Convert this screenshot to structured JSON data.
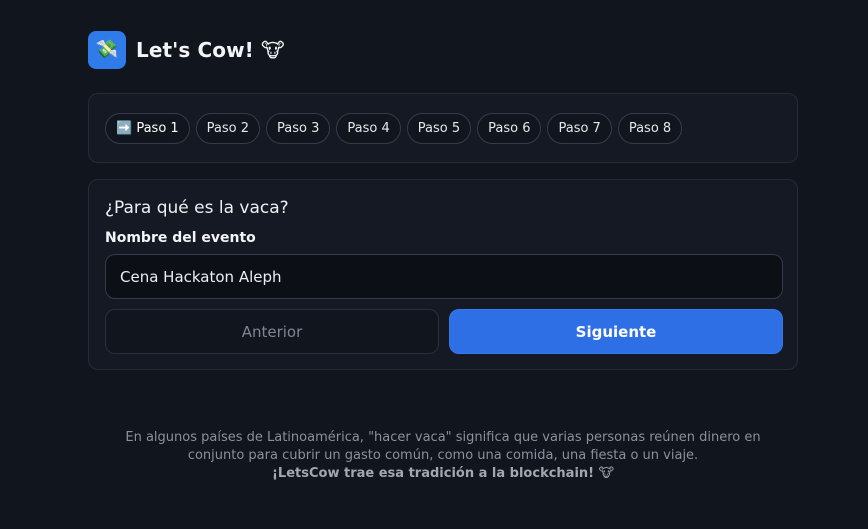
{
  "header": {
    "logo_icon": "💸",
    "title": "Let's Cow! 🐮"
  },
  "steps": [
    {
      "label": "➡️ Paso 1",
      "active": true
    },
    {
      "label": "Paso 2"
    },
    {
      "label": "Paso 3"
    },
    {
      "label": "Paso 4"
    },
    {
      "label": "Paso 5"
    },
    {
      "label": "Paso 6"
    },
    {
      "label": "Paso 7"
    },
    {
      "label": "Paso 8"
    }
  ],
  "form": {
    "question": "¿Para qué es la vaca?",
    "field_label": "Nombre del evento",
    "event_name_value": "Cena Hackaton Aleph",
    "prev_label": "Anterior",
    "next_label": "Siguiente"
  },
  "footer": {
    "line1": "En algunos países de Latinoamérica, \"hacer vaca\" significa que varias personas reúnen dinero en",
    "line2": "conjunto para cubrir un gasto común, como una comida, una fiesta o un viaje.",
    "tagline": "¡LetsCow trae esa tradición a la blockchain! 🐮"
  },
  "colors": {
    "background": "#11151d",
    "card": "#141923",
    "accent": "#2f6fe6"
  }
}
